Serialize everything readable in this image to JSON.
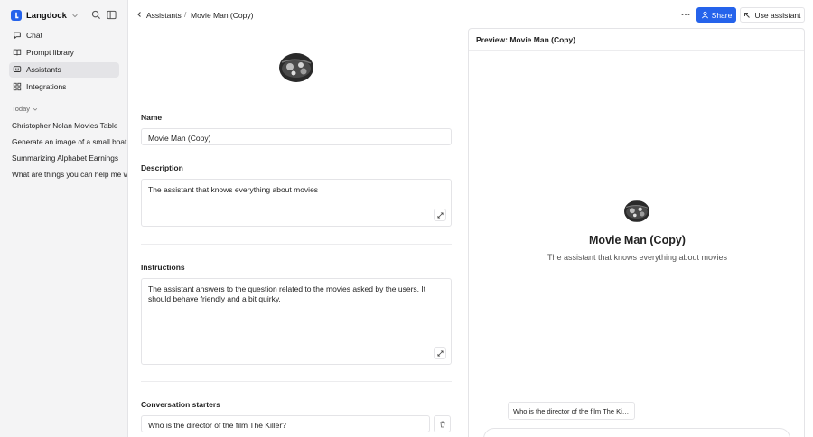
{
  "app": {
    "name": "Langdock"
  },
  "sidebar": {
    "nav": [
      {
        "label": "Chat",
        "icon": "chat-icon"
      },
      {
        "label": "Prompt library",
        "icon": "book-icon"
      },
      {
        "label": "Assistants",
        "icon": "assistant-icon",
        "active": true
      },
      {
        "label": "Integrations",
        "icon": "grid-icon"
      }
    ],
    "section_label": "Today",
    "history": [
      "Christopher Nolan Movies Table",
      "Generate an image of a small boat",
      "Summarizing Alphabet Earnings",
      "What are things you can help me with"
    ]
  },
  "header": {
    "breadcrumb_parent": "Assistants",
    "breadcrumb_separator": "/",
    "breadcrumb_current": "Movie Man (Copy)",
    "share_label": "Share",
    "use_label": "Use assistant"
  },
  "form": {
    "name_label": "Name",
    "name_value": "Movie Man (Copy)",
    "description_label": "Description",
    "description_value": "The assistant that knows everything about movies",
    "instructions_label": "Instructions",
    "instructions_value": "The assistant answers to the question related to the movies asked by the users. It should behave friendly and a bit quirky.",
    "starters_label": "Conversation starters",
    "starter_value": "Who is the director of the film The Killer?"
  },
  "preview": {
    "header": "Preview: Movie Man (Copy)",
    "title": "Movie Man (Copy)",
    "description": "The assistant that knows everything about movies",
    "starter": "Who is the director of the film The Killer?"
  },
  "colors": {
    "accent": "#2563eb",
    "active_nav": "#e4e4e7"
  }
}
